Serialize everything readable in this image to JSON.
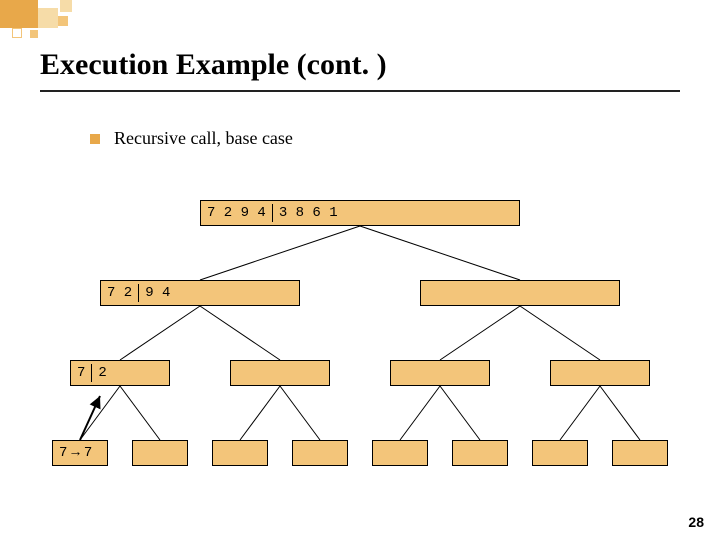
{
  "title": "Execution Example (cont. )",
  "bullet": "Recursive call, base case",
  "slide_number": "28",
  "nodes": {
    "l0": {
      "left": "7 2 9 4",
      "right": "3 8 6 1"
    },
    "l1_1": {
      "left": "7 2",
      "right": "9 4"
    },
    "l2_1": {
      "left": "7",
      "right": "2"
    },
    "l3_1": {
      "from": "7",
      "to": "7"
    }
  },
  "colors": {
    "node_fill": "#f3c57a",
    "accent": "#e8a84a"
  }
}
